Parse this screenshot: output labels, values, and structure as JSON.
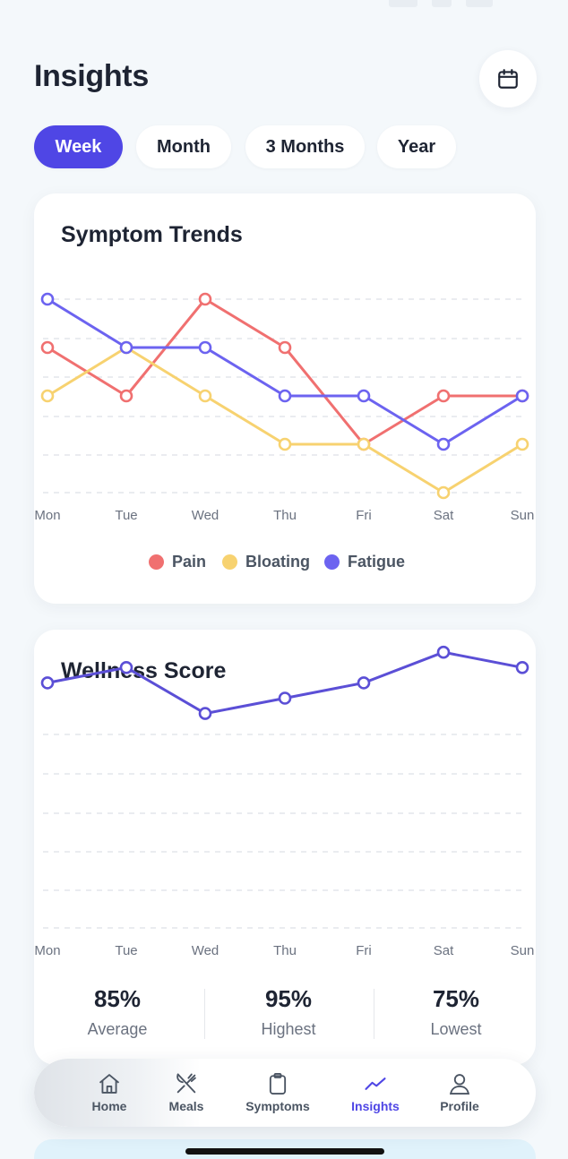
{
  "header": {
    "title": "Insights",
    "calendar_icon": "calendar-icon"
  },
  "tabs": [
    {
      "label": "Week",
      "active": true
    },
    {
      "label": "Month",
      "active": false
    },
    {
      "label": "3 Months",
      "active": false
    },
    {
      "label": "Year",
      "active": false
    }
  ],
  "colors": {
    "accent": "#4f46e5",
    "pain": "#f07070",
    "bloating": "#f7d270",
    "fatigue": "#6c63f0",
    "wellness": "#5b4fd6"
  },
  "symptom_card": {
    "title": "Symptom Trends",
    "legend": [
      {
        "label": "Pain",
        "color": "#f07070"
      },
      {
        "label": "Bloating",
        "color": "#f7d270"
      },
      {
        "label": "Fatigue",
        "color": "#6c63f0"
      }
    ]
  },
  "wellness_card": {
    "title": "Wellness Score",
    "stats": [
      {
        "value": "85%",
        "label": "Average"
      },
      {
        "value": "95%",
        "label": "Highest"
      },
      {
        "value": "75%",
        "label": "Lowest"
      }
    ]
  },
  "chart_data": [
    {
      "type": "line",
      "title": "Symptom Trends",
      "categories": [
        "Mon",
        "Tue",
        "Wed",
        "Thu",
        "Fri",
        "Sat",
        "Sun"
      ],
      "series": [
        {
          "name": "Pain",
          "values": [
            3,
            2,
            4,
            3,
            1,
            2,
            2
          ]
        },
        {
          "name": "Bloating",
          "values": [
            2,
            3,
            2,
            1,
            1,
            0,
            1
          ]
        },
        {
          "name": "Fatigue",
          "values": [
            4,
            3,
            3,
            2,
            2,
            1,
            2
          ]
        }
      ],
      "ylim": [
        0,
        4
      ],
      "grid": true,
      "legend": "bottom"
    },
    {
      "type": "line",
      "title": "Wellness Score",
      "categories": [
        "Mon",
        "Tue",
        "Wed",
        "Thu",
        "Fri",
        "Sat",
        "Sun"
      ],
      "series": [
        {
          "values": [
            80,
            85,
            70,
            75,
            80,
            90,
            85
          ]
        }
      ],
      "ylim": [
        0,
        100
      ],
      "grid": true
    }
  ],
  "nav": [
    {
      "label": "Home",
      "icon": "home-icon",
      "active": false
    },
    {
      "label": "Meals",
      "icon": "utensils-icon",
      "active": false
    },
    {
      "label": "Symptoms",
      "icon": "clipboard-icon",
      "active": false
    },
    {
      "label": "Insights",
      "icon": "trend-icon",
      "active": true
    },
    {
      "label": "Profile",
      "icon": "user-icon",
      "active": false
    }
  ]
}
